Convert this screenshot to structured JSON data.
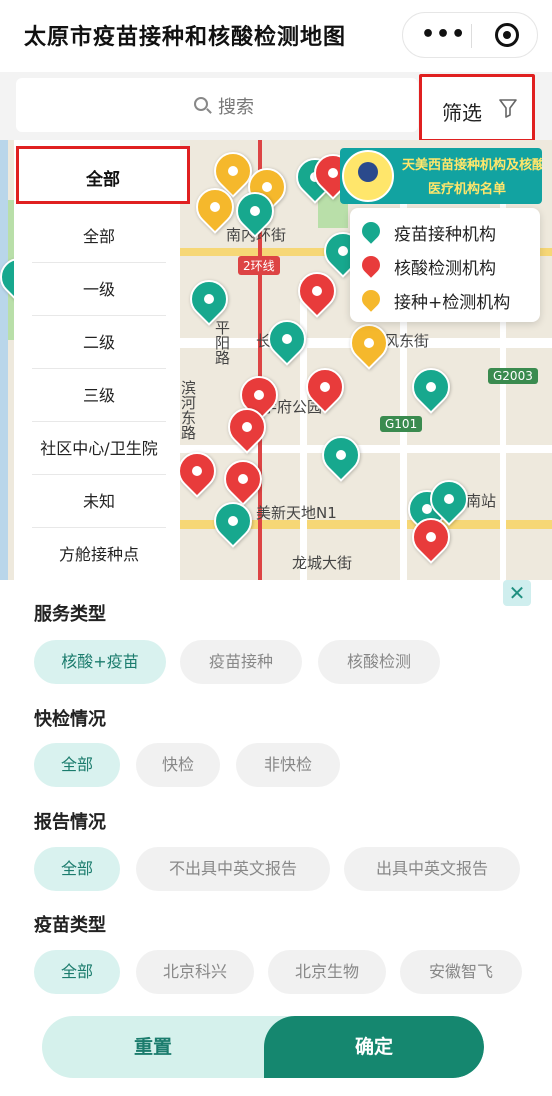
{
  "header": {
    "title": "太原市疫苗接种和核酸检测地图",
    "more_icon": "more-dots-icon",
    "close_icon": "target-circle-icon"
  },
  "search": {
    "placeholder": "搜索",
    "filter_label": "筛选"
  },
  "map": {
    "banner": {
      "line1": "天美西苗接种机构及核酸检测",
      "line2": "医疗机构名单"
    },
    "legend": [
      {
        "label": "疫苗接种机构",
        "color": "#17a88e"
      },
      {
        "label": "核酸检测机构",
        "color": "#e83b3b"
      },
      {
        "label": "接种+检测机构",
        "color": "#f5b82c"
      }
    ],
    "labels": {
      "nanneihuan": "南内环街",
      "ring2": "2环线",
      "pingyang": "平阳路",
      "changfeng": "长风街",
      "fengdong": "风东街",
      "xuefu": "学府公园",
      "binhe": "滨河东路",
      "meixin": "美新天地N1",
      "longcheng": "龙城大街",
      "zhan": "南站",
      "g2003": "G2003",
      "g101": "G101"
    }
  },
  "levels": {
    "selected": "全部",
    "items": [
      "全部",
      "一级",
      "二级",
      "三级",
      "社区中心/卫生院",
      "未知",
      "方舱接种点"
    ]
  },
  "filters": {
    "service": {
      "title": "服务类型",
      "options": [
        "核酸+疫苗",
        "疫苗接种",
        "核酸检测"
      ]
    },
    "quick": {
      "title": "快检情况",
      "options": [
        "全部",
        "快检",
        "非快检"
      ]
    },
    "report": {
      "title": "报告情况",
      "options": [
        "全部",
        "不出具中英文报告",
        "出具中英文报告"
      ]
    },
    "vaccine": {
      "title": "疫苗类型",
      "options": [
        "全部",
        "北京科兴",
        "北京生物",
        "安徽智飞"
      ]
    }
  },
  "actions": {
    "reset": "重置",
    "confirm": "确定"
  },
  "colors": {
    "accent": "#15876f",
    "highlight": "#e02020"
  }
}
